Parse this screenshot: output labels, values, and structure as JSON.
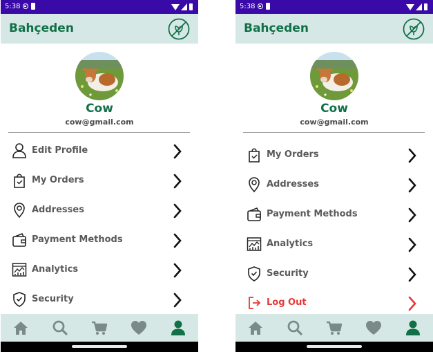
{
  "colors": {
    "status_bar": "#3a0aa8",
    "app_bar": "#d6e8e5",
    "brand_green": "#127048",
    "label_gray": "#5a5a5a",
    "logout_red": "#e53935",
    "nav_inactive": "#7a8a88",
    "nav_active": "#127048"
  },
  "left": {
    "status": {
      "time": "5:38"
    },
    "app": {
      "title": "Bahçeden"
    },
    "profile": {
      "name": "Cow",
      "email": "cow@gmail.com"
    },
    "menu": [
      {
        "label": "Edit Profile",
        "icon": "user-icon"
      },
      {
        "label": "My Orders",
        "icon": "orders-bag-icon"
      },
      {
        "label": "Addresses",
        "icon": "location-pin-icon"
      },
      {
        "label": "Payment Methods",
        "icon": "wallet-icon"
      },
      {
        "label": "Analytics",
        "icon": "analytics-icon"
      },
      {
        "label": "Security",
        "icon": "shield-check-icon"
      }
    ],
    "nav": [
      {
        "icon": "home-icon",
        "active": false
      },
      {
        "icon": "search-icon",
        "active": false
      },
      {
        "icon": "cart-icon",
        "active": false
      },
      {
        "icon": "heart-icon",
        "active": false
      },
      {
        "icon": "profile-icon",
        "active": true
      }
    ]
  },
  "right": {
    "status": {
      "time": "5:38"
    },
    "app": {
      "title": "Bahçeden"
    },
    "profile": {
      "name": "Cow",
      "email": "cow@gmail.com"
    },
    "menu": [
      {
        "label": "My Orders",
        "icon": "orders-bag-icon"
      },
      {
        "label": "Addresses",
        "icon": "location-pin-icon"
      },
      {
        "label": "Payment Methods",
        "icon": "wallet-icon"
      },
      {
        "label": "Analytics",
        "icon": "analytics-icon"
      },
      {
        "label": "Security",
        "icon": "shield-check-icon"
      },
      {
        "label": "Log Out",
        "icon": "logout-icon"
      }
    ],
    "nav": [
      {
        "icon": "home-icon",
        "active": false
      },
      {
        "icon": "search-icon",
        "active": false
      },
      {
        "icon": "cart-icon",
        "active": false
      },
      {
        "icon": "heart-icon",
        "active": false
      },
      {
        "icon": "profile-icon",
        "active": true
      }
    ]
  }
}
